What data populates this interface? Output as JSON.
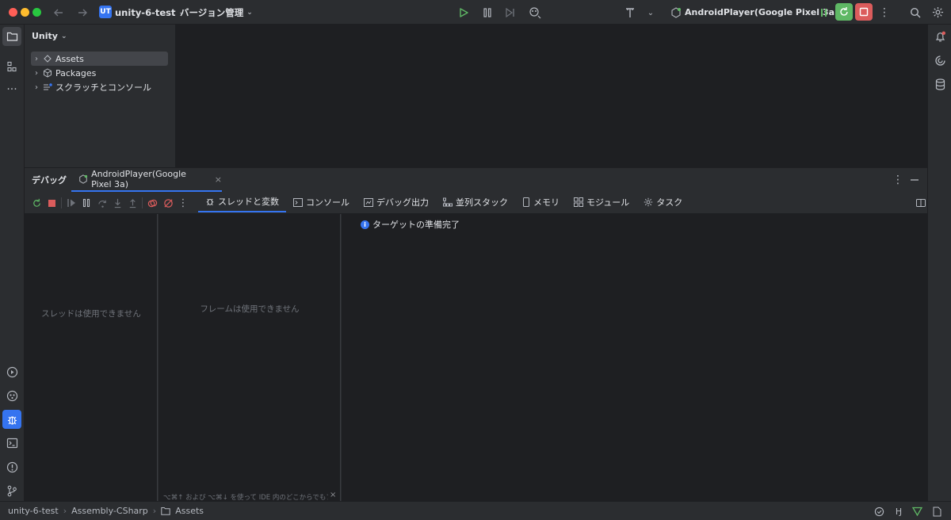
{
  "titlebar": {
    "project_badge": "UT",
    "project_name": "unity-6-test",
    "vcs_menu": "バージョン管理",
    "run_config": "AndroidPlayer(Google Pixel 3a)"
  },
  "project_pane": {
    "title": "Unity",
    "items": [
      {
        "label": "Assets"
      },
      {
        "label": "Packages"
      },
      {
        "label": "スクラッチとコンソール"
      }
    ]
  },
  "debug": {
    "panel_title": "デバッグ",
    "session_tab": "AndroidPlayer(Google Pixel 3a)",
    "tabs": [
      {
        "label": "スレッドと変数"
      },
      {
        "label": "コンソール"
      },
      {
        "label": "デバッグ出力"
      },
      {
        "label": "並列スタック"
      },
      {
        "label": "メモリ"
      },
      {
        "label": "モジュール"
      },
      {
        "label": "タスク"
      }
    ],
    "threads_empty": "スレッドは使用できません",
    "frames_empty": "フレームは使用できません",
    "frames_hint": "⌥⌘↑ および ⌥⌘↓ を使って IDE 内のどこからでもフ...",
    "status_message": "ターゲットの準備完了"
  },
  "statusbar": {
    "crumbs": [
      "unity-6-test",
      "Assembly-CSharp",
      "Assets"
    ]
  },
  "colors": {
    "accent": "#3574f0",
    "run_green": "#5fb865",
    "stop_red": "#db5c5c",
    "debug_active_bg": "#3574f0"
  }
}
